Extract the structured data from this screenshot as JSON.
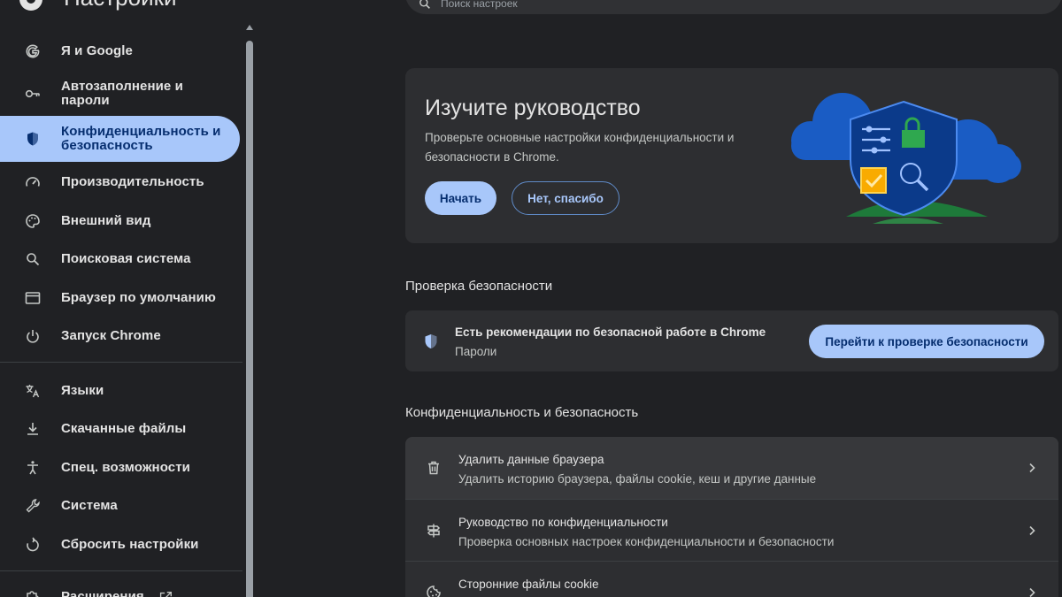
{
  "app": {
    "title": "Настройки"
  },
  "search": {
    "placeholder": "Поиск настроек"
  },
  "sidebar": {
    "items": [
      {
        "label": "Я и Google",
        "icon": "google-g-icon"
      },
      {
        "label": "Автозаполнение и пароли",
        "icon": "key-icon"
      },
      {
        "label": "Конфиденциальность и безопасность",
        "icon": "shield-icon",
        "active": true
      },
      {
        "label": "Производительность",
        "icon": "speedometer-icon"
      },
      {
        "label": "Внешний вид",
        "icon": "palette-icon"
      },
      {
        "label": "Поисковая система",
        "icon": "search-icon"
      },
      {
        "label": "Браузер по умолчанию",
        "icon": "browser-window-icon"
      },
      {
        "label": "Запуск Chrome",
        "icon": "power-icon"
      }
    ],
    "items2": [
      {
        "label": "Языки",
        "icon": "translate-icon"
      },
      {
        "label": "Скачанные файлы",
        "icon": "download-icon"
      },
      {
        "label": "Спец. возможности",
        "icon": "accessibility-icon"
      },
      {
        "label": "Система",
        "icon": "wrench-icon"
      },
      {
        "label": "Сбросить настройки",
        "icon": "reset-icon"
      }
    ],
    "items3": [
      {
        "label": "Расширения",
        "icon": "extension-icon"
      }
    ]
  },
  "guide": {
    "title": "Изучите руководство",
    "description": "Проверьте основные настройки конфиденциальности и безопасности в Chrome.",
    "start_label": "Начать",
    "dismiss_label": "Нет, спасибо"
  },
  "safety_check": {
    "section_title": "Проверка безопасности",
    "main_text": "Есть рекомендации по безопасной работе в Chrome",
    "sub_text": "Пароли",
    "button_label": "Перейти к проверке безопасности"
  },
  "privacy": {
    "section_title": "Конфиденциальность и безопасность",
    "rows": [
      {
        "title": "Удалить данные браузера",
        "subtitle": "Удалить историю браузера, файлы cookie, кеш и другие данные",
        "icon": "trash-icon"
      },
      {
        "title": "Руководство по конфиденциальности",
        "subtitle": "Проверка основных настроек конфиденциальности и безопасности",
        "icon": "signpost-icon"
      },
      {
        "title": "Сторонние файлы cookie",
        "subtitle": "",
        "icon": "cookie-icon"
      }
    ]
  },
  "colors": {
    "background": "#202124",
    "card": "#2d2e31",
    "accent": "#a8c7fa",
    "accent_text": "#062e6f"
  }
}
